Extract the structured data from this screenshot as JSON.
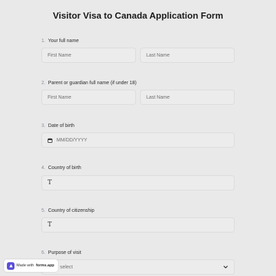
{
  "form": {
    "title": "Visitor Visa to Canada Application Form"
  },
  "questions": [
    {
      "number": "1.",
      "label": "Your full name",
      "fields": [
        {
          "placeholder": "First Name"
        },
        {
          "placeholder": "Last Name"
        }
      ]
    },
    {
      "number": "2.",
      "label": "Parent or guardian full name (if under 18)",
      "fields": [
        {
          "placeholder": "First Name"
        },
        {
          "placeholder": "Last Name"
        }
      ]
    },
    {
      "number": "3.",
      "label": "Date of birth",
      "placeholder": "MM/DD/YYYY",
      "icon": "calendar-icon"
    },
    {
      "number": "4.",
      "label": "Country of birth",
      "icon": "text-cursor-icon",
      "icon_glyph": "T"
    },
    {
      "number": "5.",
      "label": "Country of citizenship",
      "icon": "text-cursor-icon",
      "icon_glyph": "T"
    },
    {
      "number": "6.",
      "label": "Purpose of visit",
      "selected": "select",
      "icon": "chevron-down-icon"
    }
  ],
  "badge": {
    "prefix": "Made with",
    "brand": "forms.app"
  },
  "colors": {
    "background": "#e9e9e9",
    "field_bg": "#ececec",
    "number": "#8a8fa0",
    "brand": "#5b4fd9"
  }
}
